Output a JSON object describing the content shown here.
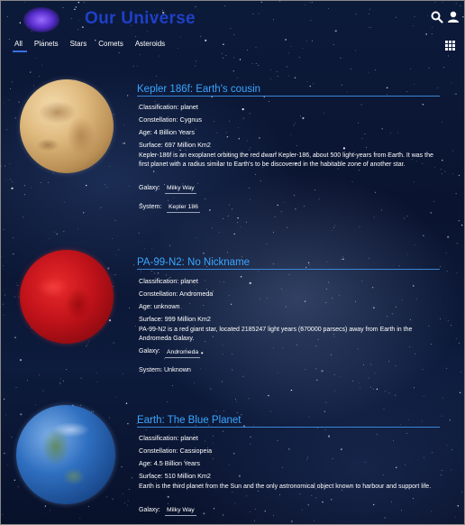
{
  "app": {
    "title": "Our Universe"
  },
  "header": {
    "search_icon": "search-icon",
    "user_icon": "user-icon",
    "grid_icon": "grid-icon"
  },
  "tabs": [
    {
      "label": "All",
      "active": true
    },
    {
      "label": "Planets",
      "active": false
    },
    {
      "label": "Stars",
      "active": false
    },
    {
      "label": "Comets",
      "active": false
    },
    {
      "label": "Asteroids",
      "active": false
    }
  ],
  "cards": [
    {
      "title": "Kepler 186f: Earth's cousin",
      "classification": "Classification: planet",
      "constellation": "Constellation: Cygnus",
      "age": "Age: 4 Billion Years",
      "surface": "Surface: 697 Million Km2",
      "description": "Kepler-186f is an exoplanet orbiting the red dwarf Kepler-186, about 500 light-years from Earth. It was the first planet with a radius similar to Earth's to be discovered in the habitable zone of another star.",
      "galaxy_label": "Galaxy:",
      "galaxy": "Milky Way",
      "system_label": "System:",
      "system": "Kepler 186",
      "planet_style": "kepler"
    },
    {
      "title": "PA-99-N2: No Nickname",
      "classification": "Classification: planet",
      "constellation": "Constellation: Andromeda",
      "age": "Age: unknown",
      "surface": "Surface: 999 Million Km2",
      "description": "PA-99-N2 is a red giant star, located 2185247 light years (670000 parsecs) away from Earth in the Andromeda Galaxy.",
      "galaxy_label": "Galaxy:",
      "galaxy": "Andromeda",
      "system_label": "System: Unknown",
      "system": "",
      "planet_style": "red"
    },
    {
      "title": "Earth: The Blue Planet",
      "classification": "Classification: planet",
      "constellation": "Constellation: Cassiopeia",
      "age": "Age: 4.5 Billion Years",
      "surface": "Surface: 510 Million Km2",
      "description": "Earth is the third planet from the Sun and the only astronomical object known to harbour and support life.",
      "galaxy_label": "Galaxy:",
      "galaxy": "Milky Way",
      "system_label": "",
      "system": "",
      "planet_style": "earth"
    }
  ],
  "colors": {
    "title": "#1e40c8",
    "card_title": "#3aa6ff",
    "tab_underline": "#3a6fe0"
  }
}
